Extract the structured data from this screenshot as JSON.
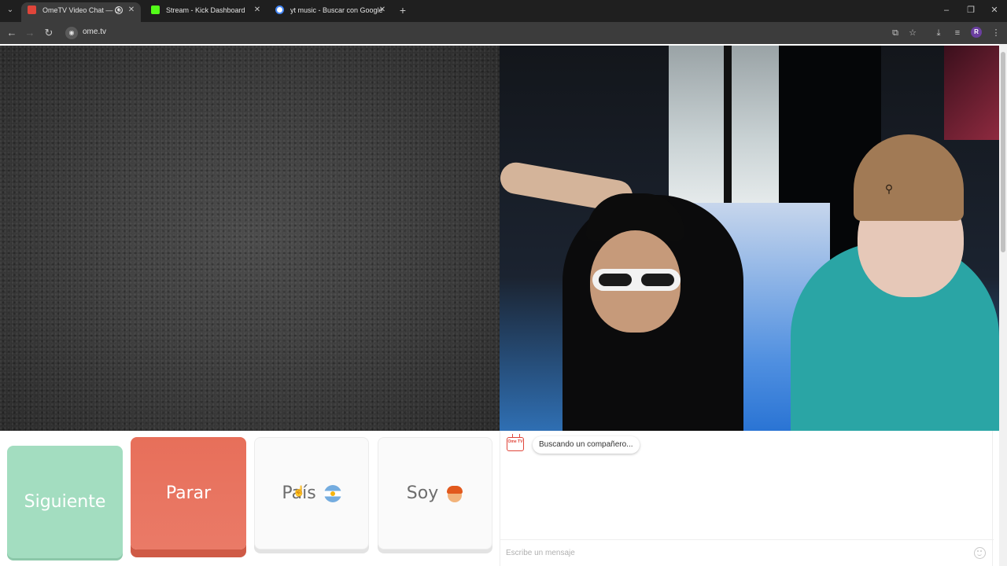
{
  "browser": {
    "tabs": [
      {
        "title": "OmeTV Video Chat — Ome",
        "active": true,
        "favicon_color": "#e0453a",
        "recording": true
      },
      {
        "title": "Stream - Kick Dashboard",
        "active": false,
        "favicon_color": "#53fc18",
        "recording": false
      },
      {
        "title": "yt music - Buscar con Google",
        "active": false,
        "favicon_color": "#4285f4",
        "recording": false
      }
    ],
    "url": "ome.tv",
    "profile_initial": "R"
  },
  "controls": {
    "next_label": "Siguiente",
    "stop_label": "Parar",
    "country_label": "País",
    "country_flag": "argentina-flag-icon",
    "gender_label": "Soy",
    "gender_icon": "boy-emoji-icon",
    "colors": {
      "next": "#a3ddc0",
      "stop": "#e76f5a",
      "neutral": "#fafafa"
    }
  },
  "chat": {
    "status_message": "Buscando un compañero...",
    "input_placeholder": "Escribe un mensaje",
    "logo_text": "Ome TV"
  }
}
